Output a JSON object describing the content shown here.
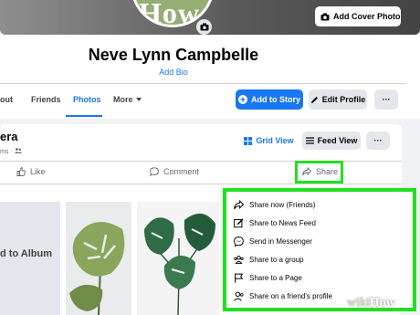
{
  "cover": {
    "add_cover_label": "Add Cover Photo",
    "avatar_watermark": "How"
  },
  "profile": {
    "name": "Neve Lynn Campbelle",
    "bio_link": "Add Bio"
  },
  "tabs": [
    {
      "label": "out"
    },
    {
      "label": "Friends"
    },
    {
      "label": "Photos"
    },
    {
      "label": "More"
    }
  ],
  "profile_actions": {
    "add_story": "Add to Story",
    "edit_profile": "Edit Profile",
    "more": "···"
  },
  "post": {
    "title_fragment": "era",
    "meta_fragment": "ms ·",
    "view_grid": "Grid View",
    "view_feed": "Feed View",
    "more": "···",
    "like": "Like",
    "comment": "Comment",
    "share": "Share"
  },
  "album": {
    "add_label": "d to Album"
  },
  "share_menu": {
    "items": [
      {
        "label": "Share now (Friends)",
        "icon": "share-arrow-icon"
      },
      {
        "label": "Share to News Feed",
        "icon": "edit-icon"
      },
      {
        "label": "Send in Messenger",
        "icon": "messenger-icon"
      },
      {
        "label": "Share to a group",
        "icon": "group-icon"
      },
      {
        "label": "Share to a Page",
        "icon": "flag-icon"
      },
      {
        "label": "Share on a friend's profile",
        "icon": "friend-icon"
      }
    ]
  },
  "watermark": {
    "wiki": "wiki",
    "how": "How"
  },
  "colors": {
    "accent": "#1877f2",
    "highlight": "#22e01d",
    "avatar_bg": "#96ad74"
  }
}
